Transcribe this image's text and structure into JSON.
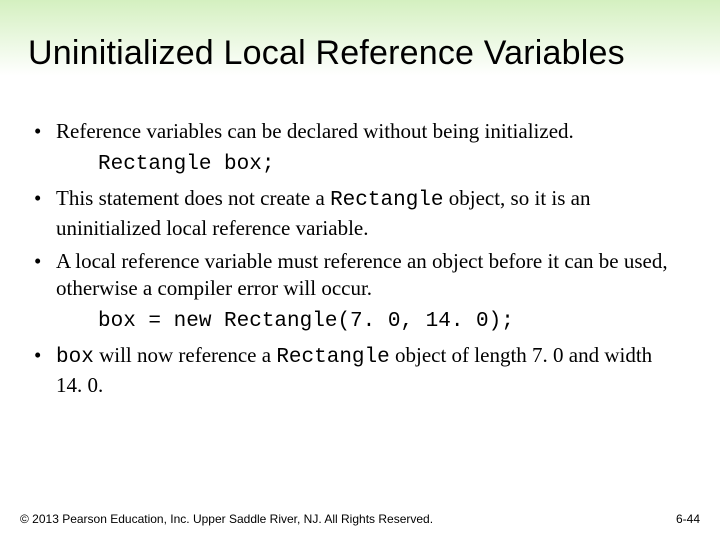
{
  "title": "Uninitialized Local Reference Variables",
  "bullets": {
    "b1": "Reference variables can be declared without being initialized.",
    "code1": "Rectangle box;",
    "b2_pre": "This statement does not create a ",
    "b2_code": "Rectangle",
    "b2_post": " object, so it is an uninitialized local reference variable.",
    "b3": "A local reference variable must reference an object before it can be used, otherwise a compiler error will occur.",
    "code2": "box = new Rectangle(7. 0, 14. 0);",
    "b4_code1": "box",
    "b4_mid1": " will now reference a ",
    "b4_code2": "Rectangle",
    "b4_post": " object of length 7. 0 and width 14. 0."
  },
  "footer": {
    "copyright": "© 2013 Pearson Education, Inc. Upper Saddle River, NJ. All Rights Reserved.",
    "page": "6-44"
  }
}
